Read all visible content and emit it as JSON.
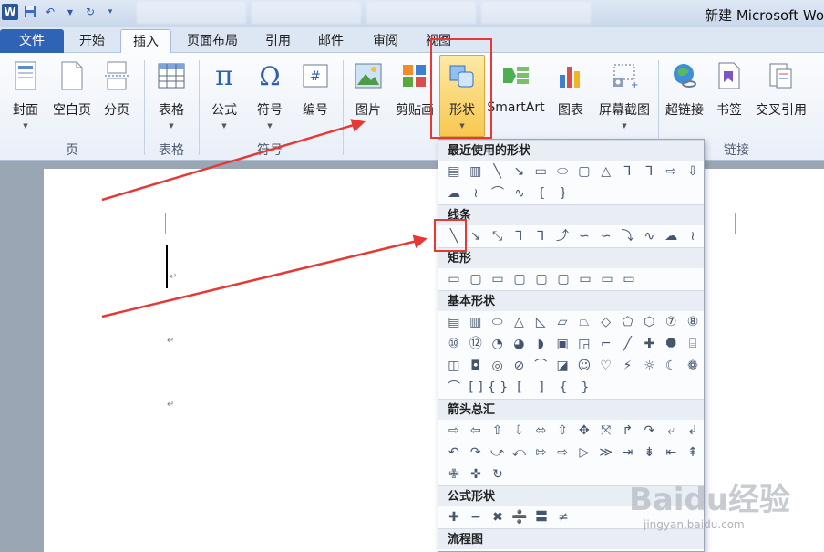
{
  "window": {
    "title": "新建 Microsoft Wo",
    "app_icon": "W"
  },
  "quick_access": [
    "save-icon",
    "undo-icon",
    "redo-icon",
    "customize-icon"
  ],
  "menu_tabs": [
    "文件",
    "开始",
    "插入",
    "页面布局",
    "引用",
    "邮件",
    "审阅",
    "视图"
  ],
  "active_tab": "插入",
  "ribbon": {
    "buttons": {
      "cover": "封面",
      "blank_page": "空白页",
      "page_break": "分页",
      "table": "表格",
      "formula": "公式",
      "symbol": "符号",
      "number": "编号",
      "picture": "图片",
      "clipart": "剪贴画",
      "shapes": "形状",
      "smartart": "SmartArt",
      "chart": "图表",
      "screenshot": "屏幕截图",
      "hyperlink": "超链接",
      "bookmark": "书签",
      "cross_ref": "交叉引用"
    },
    "groups": {
      "pages": "页",
      "tables": "表格",
      "symbols": "符号",
      "links": "链接"
    }
  },
  "dropdown": {
    "sections": [
      {
        "title": "最近使用的形状",
        "rows": [
          [
            "▤",
            "▥",
            "╲",
            "↘",
            "▭",
            "⬭",
            "▢",
            "△",
            "⅂",
            "⅂",
            "⇨",
            "⇩"
          ],
          [
            "☁",
            "≀",
            "⌒",
            "∿",
            "{",
            "}"
          ]
        ]
      },
      {
        "title": "线条",
        "rows": [
          [
            "╲",
            "↘",
            "⤡",
            "⅂",
            "⅂",
            "⤴",
            "∽",
            "∽",
            "⤵",
            "∿",
            "☁",
            "≀"
          ]
        ]
      },
      {
        "title": "矩形",
        "rows": [
          [
            "▭",
            "▢",
            "▭",
            "▢",
            "▢",
            "▢",
            "▭",
            "▭",
            "▭"
          ]
        ]
      },
      {
        "title": "基本形状",
        "rows": [
          [
            "▤",
            "▥",
            "⬭",
            "△",
            "◺",
            "▱",
            "⏢",
            "◇",
            "⬠",
            "⬡",
            "⑦",
            "⑧"
          ],
          [
            "⑩",
            "⑫",
            "◔",
            "◕",
            "◗",
            "▣",
            "◲",
            "⌐",
            "╱",
            "✚",
            "⯃",
            "⌸"
          ],
          [
            "◫",
            "◘",
            "◎",
            "⊘",
            "⌒",
            "◪",
            "☺",
            "♡",
            "⚡",
            "☼",
            "☾",
            "❁"
          ],
          [
            "⌒",
            "[ ]",
            "{ }",
            "[",
            "]",
            "{",
            "}"
          ]
        ]
      },
      {
        "title": "箭头总汇",
        "rows": [
          [
            "⇨",
            "⇦",
            "⇧",
            "⇩",
            "⬄",
            "⇳",
            "✥",
            "⤧",
            "↱",
            "↷",
            "⤶",
            "↲"
          ],
          [
            "↶",
            "↷",
            "⤻",
            "⤺",
            "⇰",
            "⇨",
            "▷",
            "≫",
            "⇥",
            "⇟",
            "⇤",
            "⇞"
          ],
          [
            "✙",
            "✜",
            "↻"
          ]
        ]
      },
      {
        "title": "公式形状",
        "rows": [
          [
            "✚",
            "━",
            "✖",
            "➗",
            "〓",
            "≠"
          ]
        ]
      },
      {
        "title": "流程图",
        "rows": []
      }
    ]
  },
  "watermark": {
    "brand": "Baidu经验",
    "site": "jingyan.baidu.com"
  }
}
